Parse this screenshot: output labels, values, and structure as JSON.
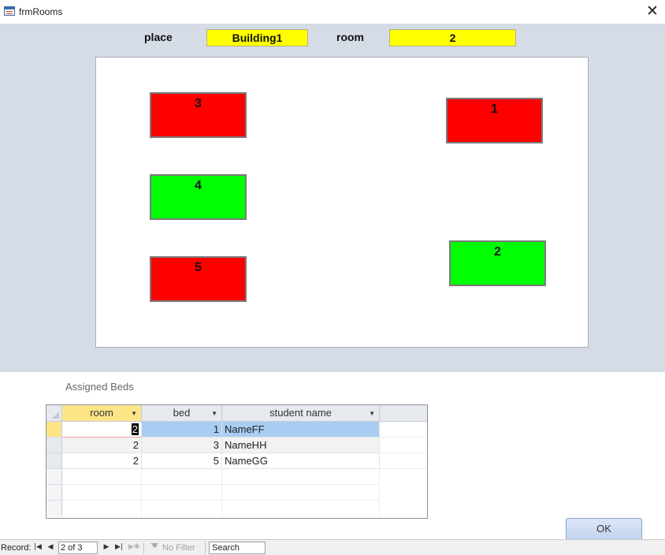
{
  "window": {
    "title": "frmRooms",
    "close_glyph": "✕"
  },
  "header": {
    "place_label": "place",
    "place_value": "Building1",
    "room_label": "room",
    "room_value": "2"
  },
  "canvas": {
    "beds": [
      {
        "label": "3",
        "status_color": "#ff0000"
      },
      {
        "label": "1",
        "status_color": "#ff0000"
      },
      {
        "label": "4",
        "status_color": "#00ff00"
      },
      {
        "label": "5",
        "status_color": "#ff0000"
      },
      {
        "label": "2",
        "status_color": "#00ff00"
      }
    ]
  },
  "subform": {
    "label": "Assigned Beds",
    "columns": [
      "room",
      "bed",
      "student name"
    ],
    "rows": [
      {
        "room": "2",
        "bed": "1",
        "student_name": "NameFF"
      },
      {
        "room": "2",
        "bed": "3",
        "student_name": "NameHH"
      },
      {
        "room": "2",
        "bed": "5",
        "student_name": "NameGG"
      }
    ]
  },
  "buttons": {
    "ok_label": "OK"
  },
  "navigation": {
    "record_label": "Record:",
    "position": "2 of 3",
    "no_filter_label": "No Filter",
    "search_placeholder": "Search"
  },
  "colors": {
    "field_highlight": "#ffff00",
    "occupied": "#ff0000",
    "free": "#00ff00",
    "form_background": "#d6dce6",
    "selected_cell": "#a9cdf2"
  }
}
